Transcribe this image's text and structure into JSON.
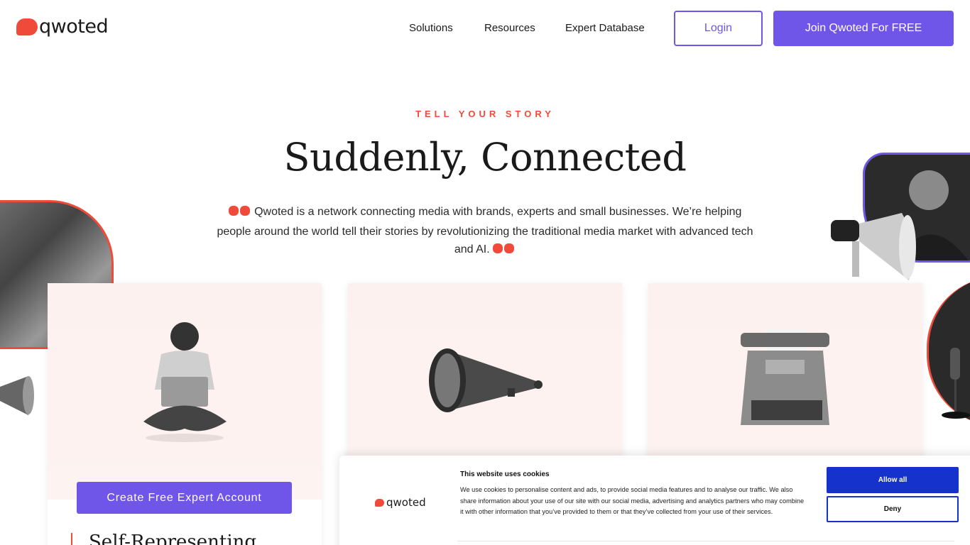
{
  "header": {
    "logo_text": "qwoted",
    "nav": [
      "Solutions",
      "Resources",
      "Expert Database"
    ],
    "login_label": "Login",
    "join_label": "Join Qwoted For FREE"
  },
  "hero": {
    "eyebrow": "TELL YOUR STORY",
    "title": "Suddenly, Connected",
    "text": "Qwoted is a network connecting media with brands, experts and small businesses. We’re helping people around the world tell their stories by revolutionizing the traditional media market with advanced tech and AI."
  },
  "cards": [
    {
      "button_label": "Create Free Expert Account",
      "heading": "Self-Representing"
    },
    {},
    {}
  ],
  "cookie": {
    "logo_text": "qwoted",
    "title": "This website uses cookies",
    "text": "We use cookies to personalise content and ads, to provide social media features and to analyse our traffic. We also share information about your use of our site with our social media, advertising and analytics partners who may combine it with other information that you’ve provided to them or that they’ve collected from your use of their services.",
    "allow_label": "Allow all",
    "deny_label": "Deny"
  },
  "colors": {
    "brand_red": "#f04b3a",
    "brand_purple": "#6f55e8",
    "cookie_blue": "#1532cc"
  }
}
